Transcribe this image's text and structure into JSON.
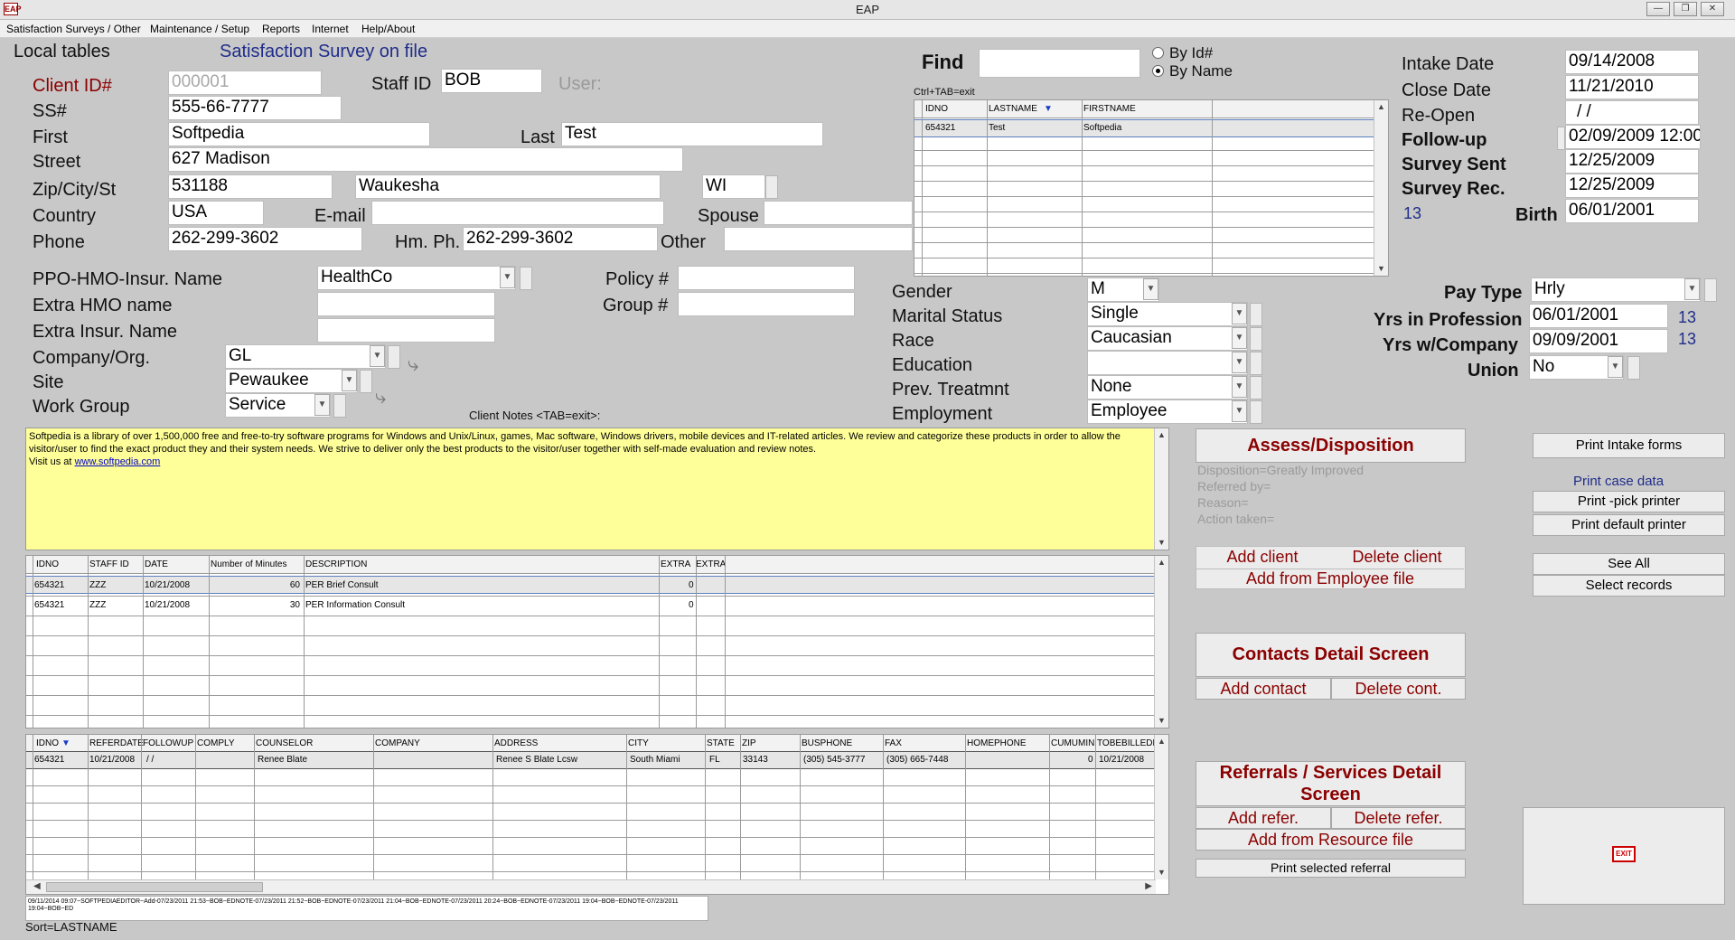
{
  "window": {
    "title": "EAP",
    "icon": "EAP"
  },
  "menu": [
    "Satisfaction Surveys / Other",
    "Maintenance / Setup",
    "Reports",
    "Internet",
    "Help/About"
  ],
  "header": {
    "local_tables": "Local tables",
    "survey_on_file": "Satisfaction Survey on file"
  },
  "client": {
    "client_id_label": "Client ID#",
    "client_id": "000001",
    "staff_id_label": "Staff ID",
    "staff_id": "BOB",
    "user_label": "User:",
    "ss_label": "SS#",
    "ss": "555-66-7777",
    "first_label": "First",
    "first": "Softpedia",
    "last_label": "Last",
    "last": "Test",
    "street_label": "Street",
    "street": "627 Madison",
    "zip_label": "Zip/City/St",
    "zip": "531188",
    "city": "Waukesha",
    "state": "WI",
    "country_label": "Country",
    "country": "USA",
    "email_label": "E-mail",
    "email": "",
    "spouse_label": "Spouse",
    "spouse": "",
    "phone_label": "Phone",
    "phone": "262-299-3602",
    "hmph_label": "Hm. Ph.",
    "hmph": "262-299-3602",
    "other_label": "Other",
    "other": ""
  },
  "insurance": {
    "ppo_label": "PPO-HMO-Insur. Name",
    "ppo": "HealthCo",
    "extra_hmo_label": "Extra HMO name",
    "extra_insur_label": "Extra Insur. Name",
    "policy_label": "Policy #",
    "group_label": "Group #",
    "company_label": "Company/Org.",
    "company": "GL",
    "site_label": "Site",
    "site": "Pewaukee",
    "workgroup_label": "Work Group",
    "workgroup": "Service"
  },
  "find": {
    "label": "Find",
    "value": "",
    "by_id": "By Id#",
    "by_name": "By Name",
    "hint": "Ctrl+TAB=exit",
    "columns": [
      "IDNO",
      "LASTNAME",
      "FIRSTNAME"
    ],
    "rows": [
      [
        "654321",
        "Test",
        "Softpedia"
      ]
    ]
  },
  "dates": {
    "intake_label": "Intake Date",
    "intake": "09/14/2008",
    "close_label": "Close Date",
    "close": "11/21/2010",
    "reopen_label": "Re-Open",
    "reopen": "/ /",
    "followup_label": "Follow-up",
    "followup": "02/09/2009 12:00",
    "sent_label": "Survey Sent",
    "sent": "12/25/2009",
    "rec_label": "Survey Rec.",
    "rec": "12/25/2009",
    "age": "13",
    "birth_label": "Birth",
    "birth": "06/01/2001"
  },
  "demographics": {
    "gender_label": "Gender",
    "gender": "M",
    "marital_label": "Marital Status",
    "marital": "Single",
    "race_label": "Race",
    "race": "Caucasian",
    "education_label": "Education",
    "education": "",
    "prev_label": "Prev. Treatmnt",
    "prev": "None",
    "employment_label": "Employment",
    "employment": "Employee"
  },
  "pay": {
    "paytype_label": "Pay Type",
    "paytype": "Hrly",
    "prof_label": "Yrs in Profession",
    "prof": "06/01/2001",
    "prof_years": "13",
    "company_label": "Yrs w/Company",
    "company": "09/09/2001",
    "company_years": "13",
    "union_label": "Union",
    "union": "No"
  },
  "notes": {
    "label": "Client Notes <TAB=exit>:",
    "text": "Softpedia is a library of over 1,500,000 free and free-to-try software programs for Windows and Unix/Linux, games, Mac software, Windows drivers, mobile devices and IT-related articles. We review and categorize these products in order to allow the visitor/user to find the exact product they and  their system needs.  We strive to deliver only the best products to the visitor/user together with self-made evaluation and review  notes.",
    "visit": "Visit us at",
    "link": "www.softpedia.com"
  },
  "contacts_grid": {
    "columns": [
      "IDNO",
      "STAFF ID",
      "DATE",
      "Number of Minutes",
      "DESCRIPTION",
      "EXTRA",
      "EXTRA"
    ],
    "rows": [
      [
        "654321",
        "ZZZ",
        "10/21/2008",
        "60",
        "PER Brief Consult",
        "0"
      ],
      [
        "654321",
        "ZZZ",
        "10/21/2008",
        "30",
        "PER Information Consult",
        "0"
      ]
    ]
  },
  "referral_grid": {
    "columns": [
      "IDNO",
      "REFERDATE",
      "FOLLOWUP",
      "COMPLY",
      "COUNSELOR",
      "COMPANY",
      "ADDRESS",
      "CITY",
      "STATE",
      "ZIP",
      "BUSPHONE",
      "FAX",
      "HOMEPHONE",
      "CUMUMIN",
      "TOBEBILLEDH"
    ],
    "rows": [
      [
        "654321",
        "10/21/2008",
        "/ /",
        "",
        "Renee Blate",
        "",
        "Renee S Blate Lcsw",
        "South Miami",
        "FL",
        "33143",
        "(305) 545-3777",
        "(305) 665-7448",
        "",
        "0",
        "10/21/2008"
      ]
    ]
  },
  "log_text": "09/11/2014 09:07~SOFTPEDIAEDITOR~Add-07/23/2011 21:53~BOB~EDNOTE-07/23/2011 21:52~BOB~EDNOTE-07/23/2011 21:04~BOB~EDNOTE-07/23/2011 20:24~BOB~EDNOTE-07/23/2011 19:04~BOB~EDNOTE-07/23/2011 19:04~BOB~ED",
  "sort_text": "Sort=LASTNAME",
  "assess": {
    "title": "Assess/Disposition",
    "disposition": "Disposition=Greatly Improved",
    "referred": "Referred by=",
    "reason": "Reason=",
    "action": "Action taken="
  },
  "actions": {
    "add_client": "Add client",
    "delete_client": "Delete client",
    "add_from_employee": "Add from Employee file",
    "contacts_title": "Contacts Detail Screen",
    "add_contact": "Add contact",
    "delete_contact": "Delete cont.",
    "referrals_title": "Referrals / Services Detail Screen",
    "add_refer": "Add refer.",
    "delete_refer": "Delete refer.",
    "add_resource": "Add from Resource file",
    "print_referral": "Print selected referral",
    "print_intake": "Print Intake forms",
    "print_case": "Print case data",
    "print_pick": "Print -pick printer",
    "print_default": "Print default printer",
    "see_all": "See All",
    "select_records": "Select records",
    "exit": "EXIT"
  }
}
